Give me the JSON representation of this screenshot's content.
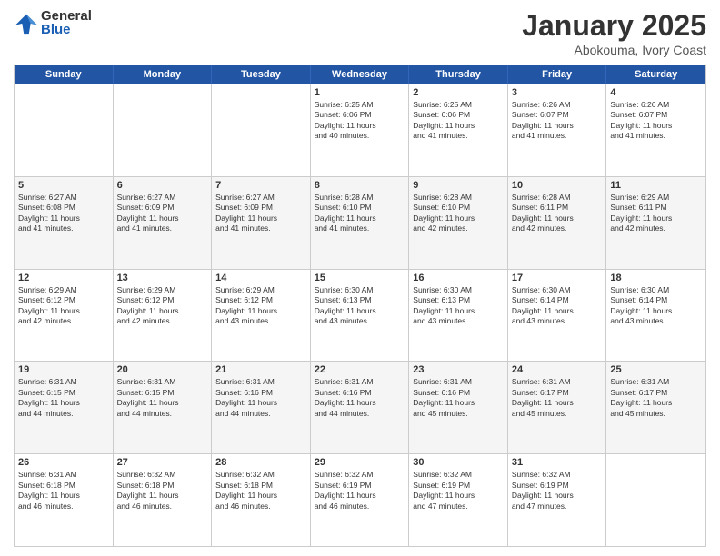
{
  "header": {
    "logo": {
      "general": "General",
      "blue": "Blue"
    },
    "title": "January 2025",
    "subtitle": "Abokouma, Ivory Coast"
  },
  "weekdays": [
    "Sunday",
    "Monday",
    "Tuesday",
    "Wednesday",
    "Thursday",
    "Friday",
    "Saturday"
  ],
  "rows": [
    [
      {
        "day": "",
        "lines": []
      },
      {
        "day": "",
        "lines": []
      },
      {
        "day": "",
        "lines": []
      },
      {
        "day": "1",
        "lines": [
          "Sunrise: 6:25 AM",
          "Sunset: 6:06 PM",
          "Daylight: 11 hours",
          "and 40 minutes."
        ]
      },
      {
        "day": "2",
        "lines": [
          "Sunrise: 6:25 AM",
          "Sunset: 6:06 PM",
          "Daylight: 11 hours",
          "and 41 minutes."
        ]
      },
      {
        "day": "3",
        "lines": [
          "Sunrise: 6:26 AM",
          "Sunset: 6:07 PM",
          "Daylight: 11 hours",
          "and 41 minutes."
        ]
      },
      {
        "day": "4",
        "lines": [
          "Sunrise: 6:26 AM",
          "Sunset: 6:07 PM",
          "Daylight: 11 hours",
          "and 41 minutes."
        ]
      }
    ],
    [
      {
        "day": "5",
        "lines": [
          "Sunrise: 6:27 AM",
          "Sunset: 6:08 PM",
          "Daylight: 11 hours",
          "and 41 minutes."
        ]
      },
      {
        "day": "6",
        "lines": [
          "Sunrise: 6:27 AM",
          "Sunset: 6:09 PM",
          "Daylight: 11 hours",
          "and 41 minutes."
        ]
      },
      {
        "day": "7",
        "lines": [
          "Sunrise: 6:27 AM",
          "Sunset: 6:09 PM",
          "Daylight: 11 hours",
          "and 41 minutes."
        ]
      },
      {
        "day": "8",
        "lines": [
          "Sunrise: 6:28 AM",
          "Sunset: 6:10 PM",
          "Daylight: 11 hours",
          "and 41 minutes."
        ]
      },
      {
        "day": "9",
        "lines": [
          "Sunrise: 6:28 AM",
          "Sunset: 6:10 PM",
          "Daylight: 11 hours",
          "and 42 minutes."
        ]
      },
      {
        "day": "10",
        "lines": [
          "Sunrise: 6:28 AM",
          "Sunset: 6:11 PM",
          "Daylight: 11 hours",
          "and 42 minutes."
        ]
      },
      {
        "day": "11",
        "lines": [
          "Sunrise: 6:29 AM",
          "Sunset: 6:11 PM",
          "Daylight: 11 hours",
          "and 42 minutes."
        ]
      }
    ],
    [
      {
        "day": "12",
        "lines": [
          "Sunrise: 6:29 AM",
          "Sunset: 6:12 PM",
          "Daylight: 11 hours",
          "and 42 minutes."
        ]
      },
      {
        "day": "13",
        "lines": [
          "Sunrise: 6:29 AM",
          "Sunset: 6:12 PM",
          "Daylight: 11 hours",
          "and 42 minutes."
        ]
      },
      {
        "day": "14",
        "lines": [
          "Sunrise: 6:29 AM",
          "Sunset: 6:12 PM",
          "Daylight: 11 hours",
          "and 43 minutes."
        ]
      },
      {
        "day": "15",
        "lines": [
          "Sunrise: 6:30 AM",
          "Sunset: 6:13 PM",
          "Daylight: 11 hours",
          "and 43 minutes."
        ]
      },
      {
        "day": "16",
        "lines": [
          "Sunrise: 6:30 AM",
          "Sunset: 6:13 PM",
          "Daylight: 11 hours",
          "and 43 minutes."
        ]
      },
      {
        "day": "17",
        "lines": [
          "Sunrise: 6:30 AM",
          "Sunset: 6:14 PM",
          "Daylight: 11 hours",
          "and 43 minutes."
        ]
      },
      {
        "day": "18",
        "lines": [
          "Sunrise: 6:30 AM",
          "Sunset: 6:14 PM",
          "Daylight: 11 hours",
          "and 43 minutes."
        ]
      }
    ],
    [
      {
        "day": "19",
        "lines": [
          "Sunrise: 6:31 AM",
          "Sunset: 6:15 PM",
          "Daylight: 11 hours",
          "and 44 minutes."
        ]
      },
      {
        "day": "20",
        "lines": [
          "Sunrise: 6:31 AM",
          "Sunset: 6:15 PM",
          "Daylight: 11 hours",
          "and 44 minutes."
        ]
      },
      {
        "day": "21",
        "lines": [
          "Sunrise: 6:31 AM",
          "Sunset: 6:16 PM",
          "Daylight: 11 hours",
          "and 44 minutes."
        ]
      },
      {
        "day": "22",
        "lines": [
          "Sunrise: 6:31 AM",
          "Sunset: 6:16 PM",
          "Daylight: 11 hours",
          "and 44 minutes."
        ]
      },
      {
        "day": "23",
        "lines": [
          "Sunrise: 6:31 AM",
          "Sunset: 6:16 PM",
          "Daylight: 11 hours",
          "and 45 minutes."
        ]
      },
      {
        "day": "24",
        "lines": [
          "Sunrise: 6:31 AM",
          "Sunset: 6:17 PM",
          "Daylight: 11 hours",
          "and 45 minutes."
        ]
      },
      {
        "day": "25",
        "lines": [
          "Sunrise: 6:31 AM",
          "Sunset: 6:17 PM",
          "Daylight: 11 hours",
          "and 45 minutes."
        ]
      }
    ],
    [
      {
        "day": "26",
        "lines": [
          "Sunrise: 6:31 AM",
          "Sunset: 6:18 PM",
          "Daylight: 11 hours",
          "and 46 minutes."
        ]
      },
      {
        "day": "27",
        "lines": [
          "Sunrise: 6:32 AM",
          "Sunset: 6:18 PM",
          "Daylight: 11 hours",
          "and 46 minutes."
        ]
      },
      {
        "day": "28",
        "lines": [
          "Sunrise: 6:32 AM",
          "Sunset: 6:18 PM",
          "Daylight: 11 hours",
          "and 46 minutes."
        ]
      },
      {
        "day": "29",
        "lines": [
          "Sunrise: 6:32 AM",
          "Sunset: 6:19 PM",
          "Daylight: 11 hours",
          "and 46 minutes."
        ]
      },
      {
        "day": "30",
        "lines": [
          "Sunrise: 6:32 AM",
          "Sunset: 6:19 PM",
          "Daylight: 11 hours",
          "and 47 minutes."
        ]
      },
      {
        "day": "31",
        "lines": [
          "Sunrise: 6:32 AM",
          "Sunset: 6:19 PM",
          "Daylight: 11 hours",
          "and 47 minutes."
        ]
      },
      {
        "day": "",
        "lines": []
      }
    ]
  ]
}
